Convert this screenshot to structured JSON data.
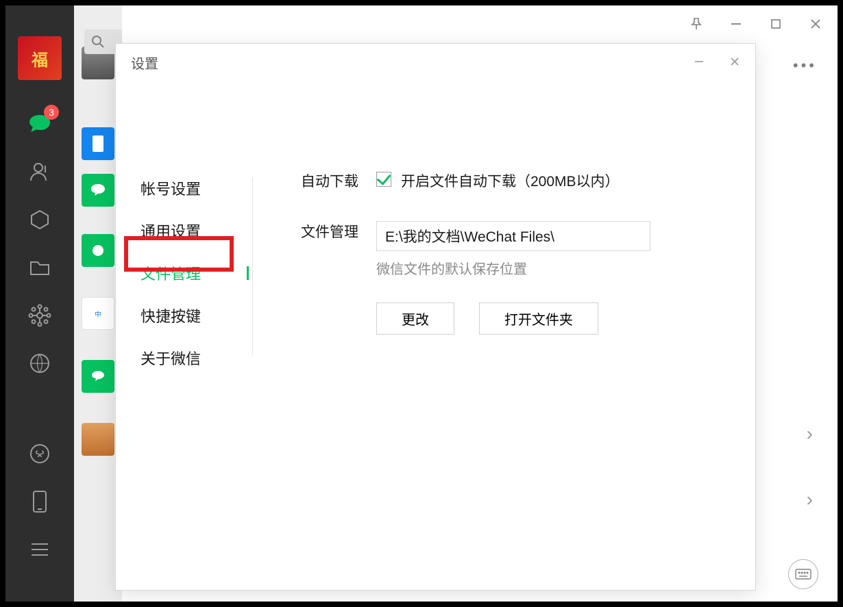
{
  "app": {
    "chat_badge": "3"
  },
  "settings": {
    "title": "设置",
    "nav": {
      "account": "帐号设置",
      "general": "通用设置",
      "files": "文件管理",
      "shortcut": "快捷按键",
      "about": "关于微信"
    },
    "content": {
      "auto_download_label": "自动下载",
      "auto_download_text": "开启文件自动下载（200MB以内）",
      "file_mgmt_label": "文件管理",
      "file_path": "E:\\我的文档\\WeChat Files\\",
      "file_hint": "微信文件的默认保存位置",
      "change_btn": "更改",
      "open_folder_btn": "打开文件夹"
    }
  }
}
